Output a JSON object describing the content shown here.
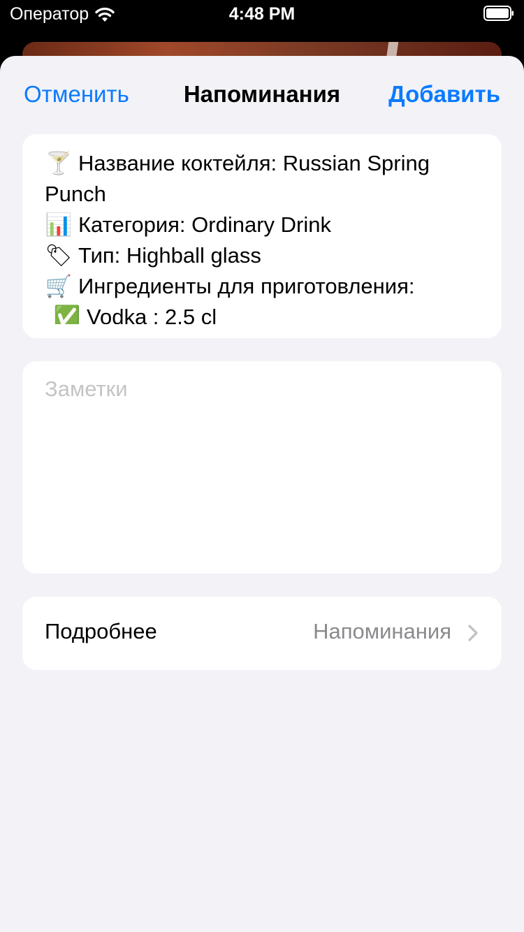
{
  "status_bar": {
    "carrier": "Оператор",
    "time": "4:48 PM"
  },
  "nav": {
    "cancel_label": "Отменить",
    "title": "Напоминания",
    "add_label": "Добавить"
  },
  "content": {
    "lines": [
      {
        "icon": "cocktail-glass-icon",
        "glyph": "🍸",
        "text": "Название коктейля: Russian Spring"
      },
      {
        "icon": "",
        "glyph": "",
        "text": "Punch"
      },
      {
        "icon": "bar-chart-icon",
        "glyph": "📊",
        "text": "Категория: Ordinary Drink"
      },
      {
        "icon": "label-tag-icon",
        "glyph": "🏷",
        "text": "Тип: Highball glass"
      },
      {
        "icon": "shopping-cart-icon",
        "glyph": "🛒",
        "text": "Ингредиенты для приготовления:"
      },
      {
        "icon": "check-mark-icon",
        "glyph": "✅",
        "text": "Vodka : 2.5 cl"
      }
    ]
  },
  "notes": {
    "placeholder": "Заметки",
    "value": ""
  },
  "details": {
    "label": "Подробнее",
    "value": "Напоминания"
  },
  "colors": {
    "accent": "#0a7aff",
    "sheet_background": "#f2f2f7",
    "secondary_text": "#8a8a8e",
    "placeholder_text": "#c4c4c6"
  }
}
